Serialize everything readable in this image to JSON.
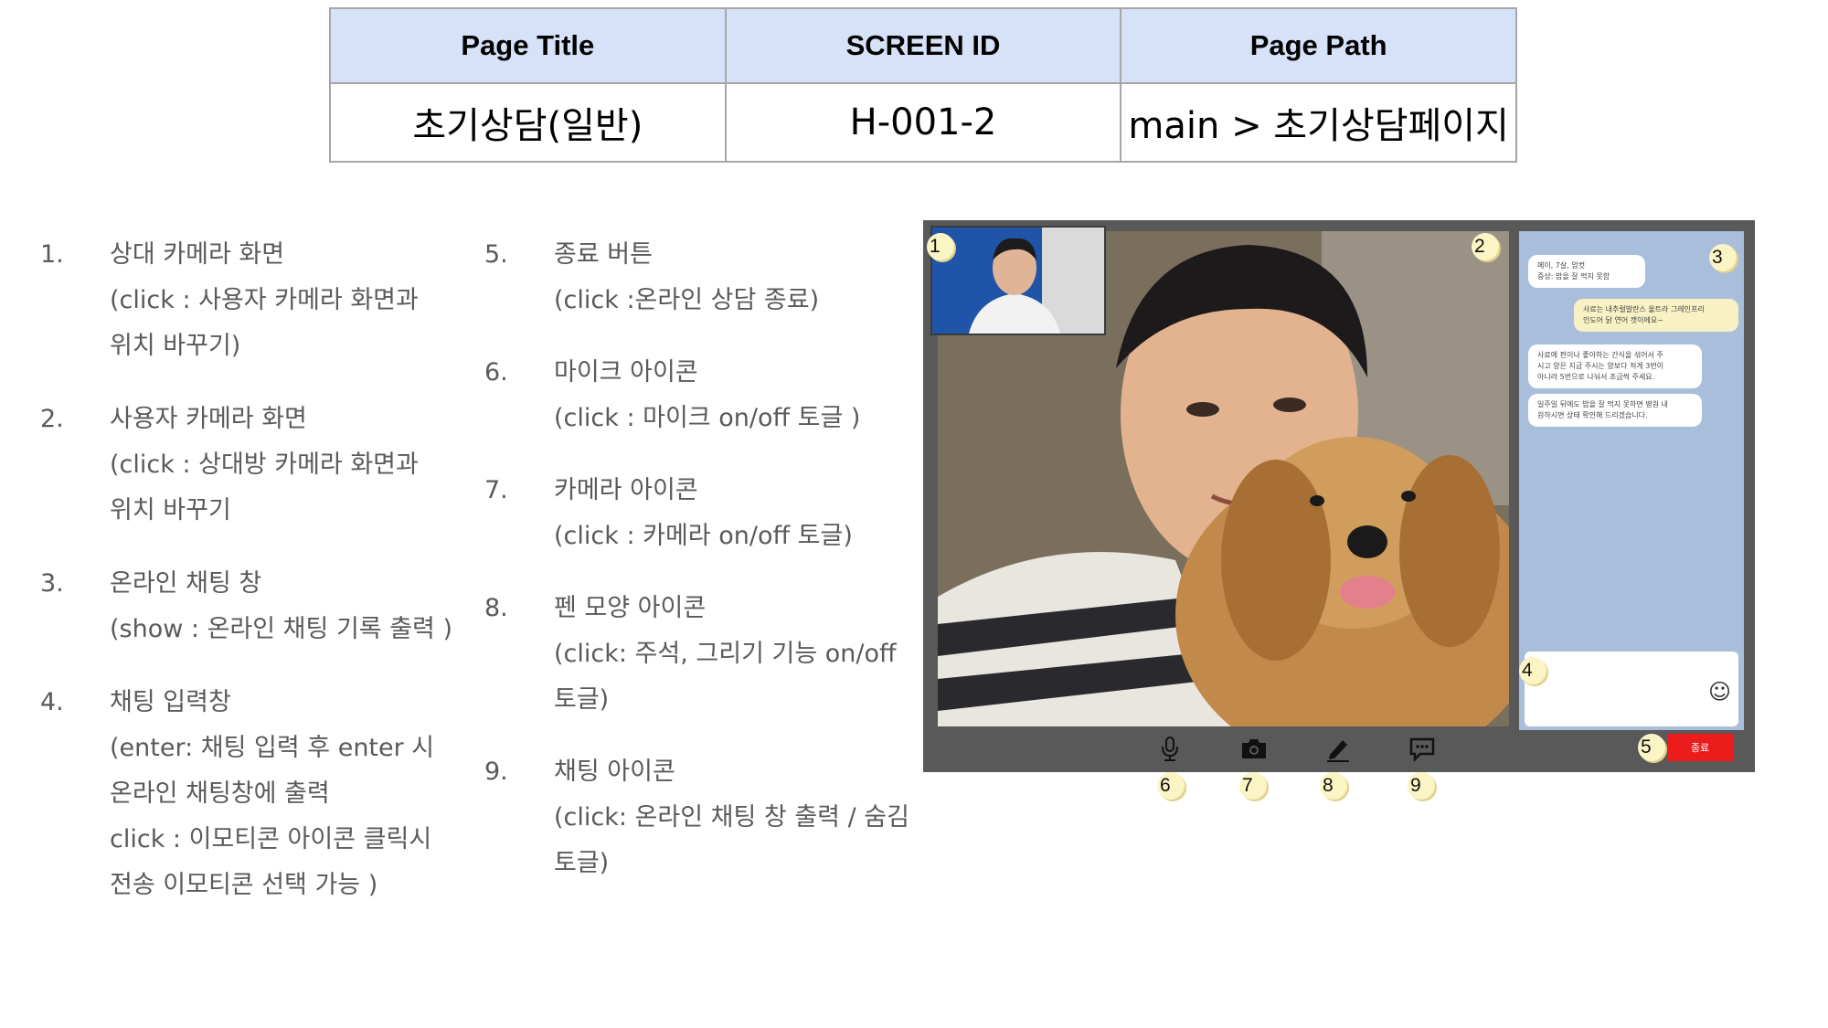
{
  "header_table": {
    "columns": [
      "Page Title",
      "SCREEN ID",
      "Page Path"
    ],
    "values": [
      "초기상담(일반)",
      "H-001-2",
      "main > 초기상담페이지"
    ]
  },
  "descriptions_left": [
    {
      "num": "1.",
      "lines": [
        "상대 카메라 화면",
        "(click : 사용자 카메라 화면과",
        "위치 바꾸기)"
      ]
    },
    {
      "num": "2.",
      "lines": [
        "사용자 카메라 화면",
        "(click : 상대방 카메라 화면과",
        "위치 바꾸기"
      ]
    },
    {
      "num": "3.",
      "lines": [
        "온라인 채팅 창",
        "(show : 온라인 채팅  기록 출력 )"
      ]
    },
    {
      "num": "4.",
      "lines": [
        "채팅 입력창",
        "(enter: 채팅 입력 후 enter 시",
        "온라인 채팅창에 출력",
        "click : 이모티콘 아이콘 클릭시",
        "전송 이모티콘 선택 가능 )"
      ]
    }
  ],
  "descriptions_right": [
    {
      "num": "5.",
      "lines": [
        "종료 버튼",
        "(click :온라인 상담 종료)"
      ]
    },
    {
      "num": "6.",
      "lines": [
        "마이크 아이콘",
        "(click : 마이크 on/off 토글 )"
      ]
    },
    {
      "num": "7.",
      "lines": [
        "카메라 아이콘",
        "(click : 카메라 on/off 토글)"
      ]
    },
    {
      "num": "8.",
      "lines": [
        "펜 모양 아이콘",
        "(click: 주석, 그리기 기능 on/off",
        "토글)"
      ]
    },
    {
      "num": "9.",
      "lines": [
        "채팅 아이콘",
        "(click: 온라인 채팅 창 출력 / 숨김",
        "토글)"
      ]
    }
  ],
  "mockup": {
    "chat_messages": [
      {
        "side": "incoming",
        "text": "메이, 7살, 암컷\n증상: 밥을 잘 먹지 못함"
      },
      {
        "side": "outgoing",
        "text": "사료는 내추럴발란스 울트라 그레인프리\n인도어 닭 연어 캣이에요~"
      },
      {
        "side": "incoming",
        "text": "사료에 펀이나 좋아하는 간식을 섞어서 주\n시고 양은 지금 주시는 양보다 적게 3번이\n아니라 5번으로 나눠서 조금씩 주세요."
      },
      {
        "side": "incoming",
        "text": "일주일 뒤에도 밥을 잘 먹지 못하면 병원 내\n원하시면 상태 확인해 드리겠습니다."
      }
    ],
    "end_button_label": "종료",
    "emoji_icon": "smiley-icon",
    "toolbar_icons": [
      "microphone-icon",
      "camera-icon",
      "pen-icon",
      "chat-icon"
    ],
    "markers": [
      "1",
      "2",
      "3",
      "4",
      "5",
      "6",
      "7",
      "8",
      "9"
    ],
    "colors": {
      "frame": "#595959",
      "chat_bg": "#a9bedb",
      "end_button": "#ec1c1c",
      "header_bg": "#d6e2f8"
    }
  }
}
